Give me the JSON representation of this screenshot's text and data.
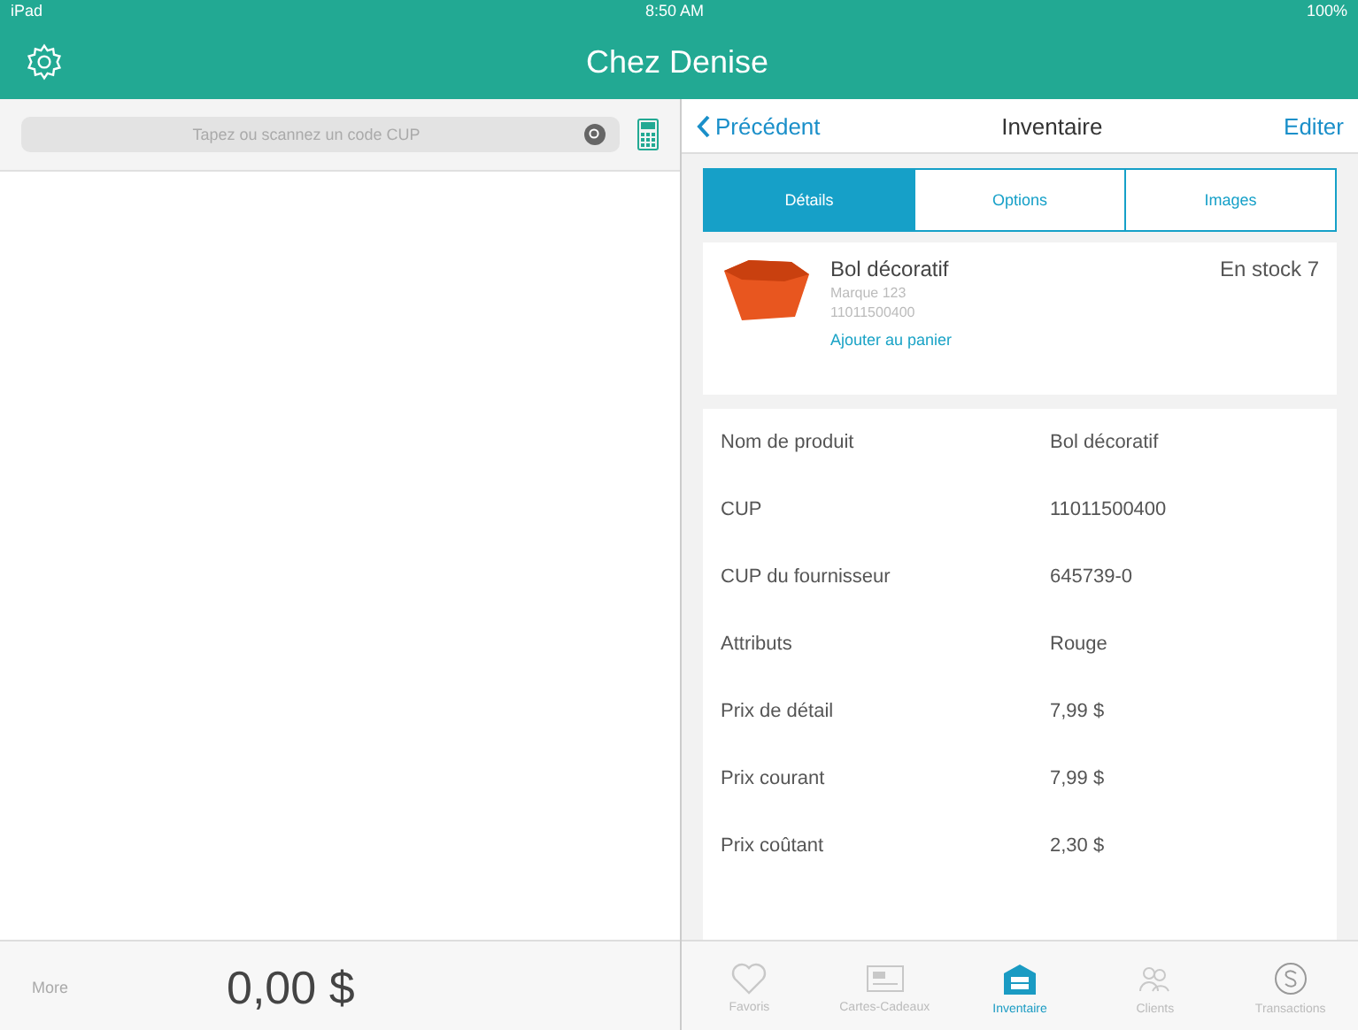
{
  "status_bar": {
    "device": "iPad",
    "time": "8:50 AM",
    "battery": "100%"
  },
  "header": {
    "title": "Chez Denise"
  },
  "search": {
    "placeholder": "Tapez ou scannez un code CUP"
  },
  "cart": {
    "more": "More",
    "total": "0,00 $"
  },
  "nav": {
    "back": "Précédent",
    "title": "Inventaire",
    "action": "Editer"
  },
  "tabs": [
    {
      "label": "Détails",
      "selected": true
    },
    {
      "label": "Options",
      "selected": false
    },
    {
      "label": "Images",
      "selected": false
    }
  ],
  "product": {
    "name": "Bol décoratif",
    "brand": "Marque 123",
    "code": "11011500400",
    "add": "Ajouter au panier",
    "stock": "En stock 7"
  },
  "fields": [
    {
      "label": "Nom de produit",
      "value": "Bol décoratif"
    },
    {
      "label": "CUP",
      "value": "11011500400"
    },
    {
      "label": "CUP du fournisseur",
      "value": "645739-0"
    },
    {
      "label": "Attributs",
      "value": "Rouge"
    },
    {
      "label": "Prix de détail",
      "value": "7,99 $"
    },
    {
      "label": "Prix courant",
      "value": "7,99 $"
    },
    {
      "label": "Prix coûtant",
      "value": "2,30 $"
    }
  ],
  "tab_bar": [
    {
      "kind": "heart",
      "label": "Favoris",
      "selected": false
    },
    {
      "kind": "card",
      "label": "Cartes-Cadeaux",
      "selected": false
    },
    {
      "kind": "store",
      "label": "Inventaire",
      "selected": true
    },
    {
      "kind": "people",
      "label": "Clients",
      "selected": false
    },
    {
      "kind": "dollar",
      "label": "Transactions",
      "selected": false
    }
  ]
}
